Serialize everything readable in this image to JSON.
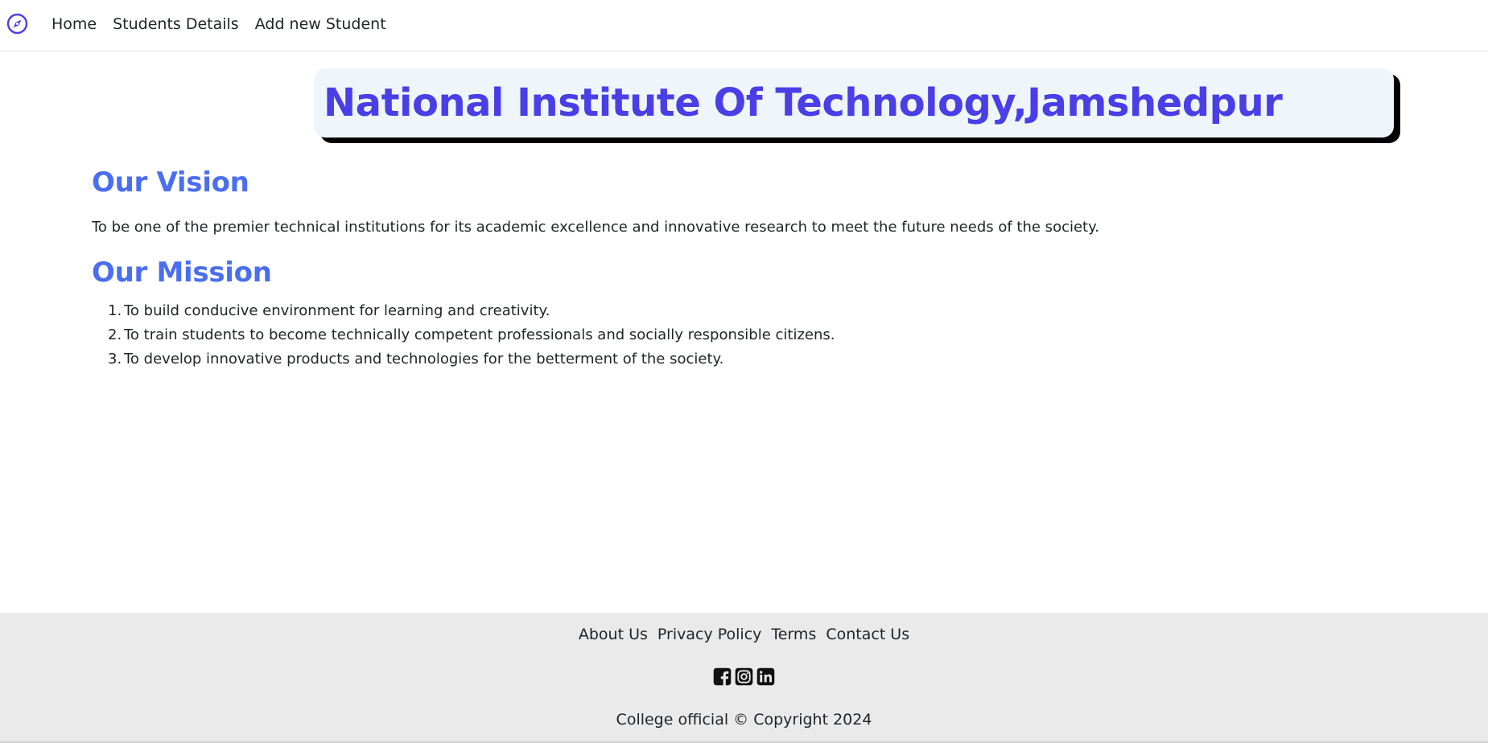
{
  "navbar": {
    "logo_icon": "compass-icon",
    "links": [
      {
        "label": "Home"
      },
      {
        "label": "Students Details"
      },
      {
        "label": "Add new Student"
      }
    ]
  },
  "banner": {
    "title": "National Institute Of Technology,Jamshedpur"
  },
  "vision": {
    "heading": "Our Vision",
    "text": "To be one of the premier technical institutions for its academic excellence and innovative research to meet the future needs of the society."
  },
  "mission": {
    "heading": "Our Mission",
    "items": [
      {
        "num": "1.",
        "text": "To build conducive environment for learning and creativity."
      },
      {
        "num": "2.",
        "text": "To train students to become technically competent professionals and socially responsible citizens."
      },
      {
        "num": "3.",
        "text": "To develop innovative products and technologies for the betterment of the society."
      }
    ]
  },
  "footer": {
    "links": [
      {
        "label": "About Us"
      },
      {
        "label": "Privacy Policy"
      },
      {
        "label": "Terms"
      },
      {
        "label": "Contact Us"
      }
    ],
    "social_icons": [
      "facebook-icon",
      "instagram-icon",
      "linkedin-icon"
    ],
    "copyright": "College official © Copyright 2024"
  },
  "colors": {
    "title": "#4b3ee6",
    "heading": "#4a6ef0",
    "banner_bg": "#eef6fc",
    "footer_bg": "#eaeaea"
  }
}
